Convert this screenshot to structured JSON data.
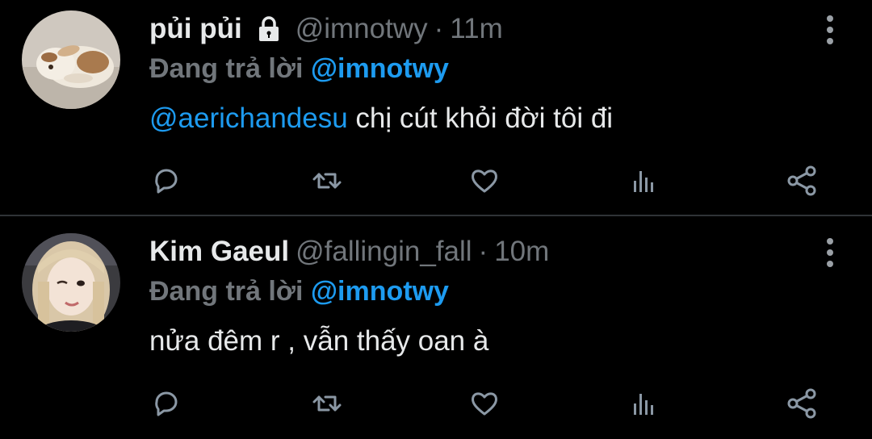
{
  "colors": {
    "background": "#000000",
    "divider": "#2f3336",
    "text_primary": "#e7e9ea",
    "text_secondary": "#71767b",
    "accent_link": "#1d9bf0"
  },
  "tweets": [
    {
      "display_name": "pủi pủi",
      "protected": true,
      "protected_icon": "lock-icon",
      "handle": "@imnotwy",
      "separator": "·",
      "time": "11m",
      "reply_prefix": "Đang trả lời",
      "reply_to": "@imnotwy",
      "mention": "@aerichandesu",
      "text": " chị cút khỏi đời tôi đi",
      "avatar": "bunny-avatar"
    },
    {
      "display_name": "Kim Gaeul",
      "protected": false,
      "handle": "@fallingin_fall",
      "separator": "·",
      "time": "10m",
      "reply_prefix": "Đang trả lời",
      "reply_to": "@imnotwy",
      "mention": "",
      "text": "nửa đêm r , vẫn thấy oan à",
      "avatar": "person-avatar"
    }
  ],
  "actions": [
    "reply-icon",
    "retweet-icon",
    "like-icon",
    "views-icon",
    "share-icon"
  ],
  "menu_icon": "more-vertical-icon"
}
